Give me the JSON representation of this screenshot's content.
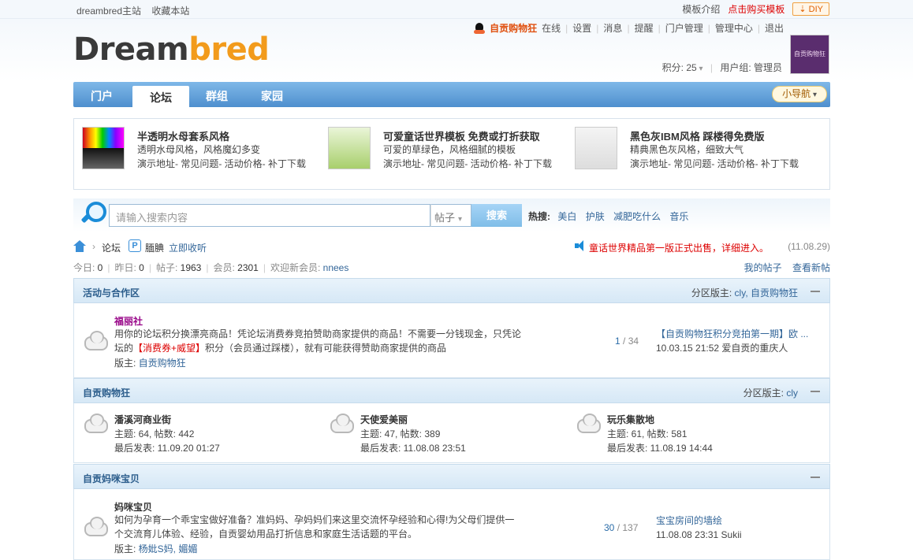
{
  "topbar": {
    "site_home": "dreambred主站",
    "bookmark": "收藏本站",
    "template_intro": "模板介绍",
    "buy_template": "点击购买模板",
    "diy": "DIY"
  },
  "logo": {
    "part1": "Dream",
    "part2": "bred"
  },
  "user": {
    "name": "自贡购物狂",
    "status": "在线",
    "links": [
      "设置",
      "消息",
      "提醒",
      "门户管理",
      "管理中心",
      "退出"
    ],
    "points_label": "积分: 25",
    "group_label": "用户组: 管理员",
    "avatar_text": "自贡购物狂"
  },
  "nav": {
    "tabs": [
      "门户",
      "论坛",
      "群组",
      "家园"
    ],
    "mini_nav": "小导航"
  },
  "ads": [
    {
      "title": "半透明水母套系风格",
      "desc": "透明水母风格，风格魔幻多变",
      "links": "演示地址- 常见问题- 活动价格- 补丁下载"
    },
    {
      "title": "可爱童话世界模板  免费或打折获取",
      "desc": "可爱的草绿色，风格细腻的模板",
      "links": "演示地址- 常见问题- 活动价格- 补丁下载"
    },
    {
      "title": "黑色灰IBM风格  踩楼得免费版",
      "desc": "精典黑色灰风格，细致大气",
      "links": "演示地址- 常见问题- 活动价格- 补丁下载"
    }
  ],
  "search": {
    "placeholder": "请输入搜索内容",
    "scope": "帖子",
    "button": "搜索",
    "hot_label": "热搜:",
    "hot": [
      "美白",
      "护肤",
      "减肥吃什么",
      "音乐"
    ]
  },
  "crumb": {
    "forum": "论坛",
    "rss_name": "腼腆",
    "rss_link": "立即收听",
    "notice": "童话世界精品第一版正式出售，详细进入。",
    "notice_date": "(11.08.29)"
  },
  "stats": {
    "today": "今日: ",
    "today_n": "0",
    "yesterday": "昨日: ",
    "yesterday_n": "0",
    "posts": "帖子: ",
    "posts_n": "1963",
    "members": "会员: ",
    "members_n": "2301",
    "newest": "欢迎新会员: ",
    "newest_name": "nnees",
    "my_posts": "我的帖子",
    "new_posts": "查看新帖"
  },
  "sections": {
    "s1": {
      "name": "活动与合作区",
      "mod_label": "分区版主: ",
      "mod_names": "cly, 自贡购物狂",
      "forum": {
        "name": "福丽社",
        "desc1": "用你的论坛积分换漂亮商品！凭论坛消费券竞拍赞助商家提供的商品！不需要一分钱现金，只凭论",
        "desc2a": "坛的",
        "desc2red": "【消费券+威望】",
        "desc2b": "积分（会员通过踩楼），就有可能获得赞助商家提供的商品",
        "mod_label": "版主: ",
        "mod_name": "自贡购物狂",
        "threads": "1",
        "posts": " / 34",
        "last_title": "【自贡购物狂积分竞拍第一期】欧 ...",
        "last_time": "10.03.15 21:52 爱自贡的重庆人"
      }
    },
    "s2": {
      "name": "自贡购物狂",
      "mod_label": "分区版主: ",
      "mod_names": "cly",
      "forums": [
        {
          "name": "潘溪河商业街",
          "counts": "主题: 64, 帖数: 442",
          "last": "最后发表: 11.09.20 01:27"
        },
        {
          "name": "天使爱美丽",
          "counts": "主题: 47, 帖数: 389",
          "last": "最后发表: 11.08.08 23:51"
        },
        {
          "name": "玩乐集散地",
          "counts": "主题: 61, 帖数: 581",
          "last": "最后发表: 11.08.19 14:44"
        }
      ]
    },
    "s3": {
      "name": "自贡妈咪宝贝",
      "forum": {
        "name": "妈咪宝贝",
        "desc1": "如何为孕育一个乖宝宝做好准备？准妈妈、孕妈妈们来这里交流怀孕经验和心得!为父母们提供一",
        "desc2": "个交流育儿体验、经验，自贡婴幼用品打折信息和家庭生活话题的平台。",
        "mod_label": "版主: ",
        "mod_name": "杨妣S妈, 媚媚",
        "threads": "30",
        "posts": " / 137",
        "last_title": "宝宝房间的墙绘",
        "last_time": "11.08.08 23:31 Sukii"
      }
    }
  }
}
